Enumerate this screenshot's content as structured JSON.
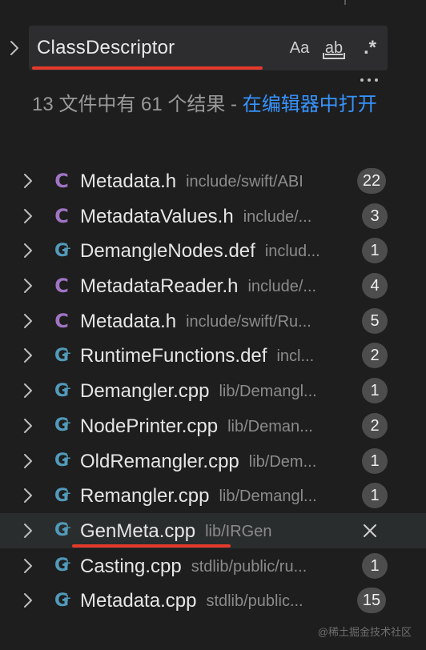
{
  "search": {
    "value": "ClassDescriptor",
    "options": {
      "match_case": "Aa",
      "match_word": "ab",
      "regex": ".*"
    }
  },
  "summary": {
    "text": "13 文件中有 61 个结果 - ",
    "link": "在编辑器中打开"
  },
  "icons": {
    "toggle": "chevron-right-icon",
    "more": "more-actions-icon",
    "header_file": "c-header-file-icon",
    "cpp_file": "cpp-file-icon",
    "dismiss": "close-icon"
  },
  "colors": {
    "accent_link": "#3794ff",
    "header_icon": "#a074c4",
    "cpp_icon": "#519aba",
    "highlight_underline": "#e53a2b",
    "badge_bg": "#4d4d4d"
  },
  "results": [
    {
      "icon": "c-header-file-icon",
      "name": "Metadata.h",
      "path": "include/swift/ABI",
      "count": "22"
    },
    {
      "icon": "c-header-file-icon",
      "name": "MetadataValues.h",
      "path": "include/...",
      "count": "3"
    },
    {
      "icon": "cpp-file-icon",
      "name": "DemangleNodes.def",
      "path": "includ...",
      "count": "1"
    },
    {
      "icon": "c-header-file-icon",
      "name": "MetadataReader.h",
      "path": "include/...",
      "count": "4"
    },
    {
      "icon": "c-header-file-icon",
      "name": "Metadata.h",
      "path": "include/swift/Ru...",
      "count": "5"
    },
    {
      "icon": "cpp-file-icon",
      "name": "RuntimeFunctions.def",
      "path": "incl...",
      "count": "2"
    },
    {
      "icon": "cpp-file-icon",
      "name": "Demangler.cpp",
      "path": "lib/Demangl...",
      "count": "1"
    },
    {
      "icon": "cpp-file-icon",
      "name": "NodePrinter.cpp",
      "path": "lib/Deman...",
      "count": "2"
    },
    {
      "icon": "cpp-file-icon",
      "name": "OldRemangler.cpp",
      "path": "lib/Dem...",
      "count": "1"
    },
    {
      "icon": "cpp-file-icon",
      "name": "Remangler.cpp",
      "path": "lib/Demangl...",
      "count": "1"
    },
    {
      "icon": "cpp-file-icon",
      "name": "GenMeta.cpp",
      "path": "lib/IRGen",
      "count": "",
      "active": true
    },
    {
      "icon": "cpp-file-icon",
      "name": "Casting.cpp",
      "path": "stdlib/public/ru...",
      "count": "1"
    },
    {
      "icon": "cpp-file-icon",
      "name": "Metadata.cpp",
      "path": "stdlib/public...",
      "count": "15"
    }
  ],
  "watermark": "@稀土掘金技术社区"
}
